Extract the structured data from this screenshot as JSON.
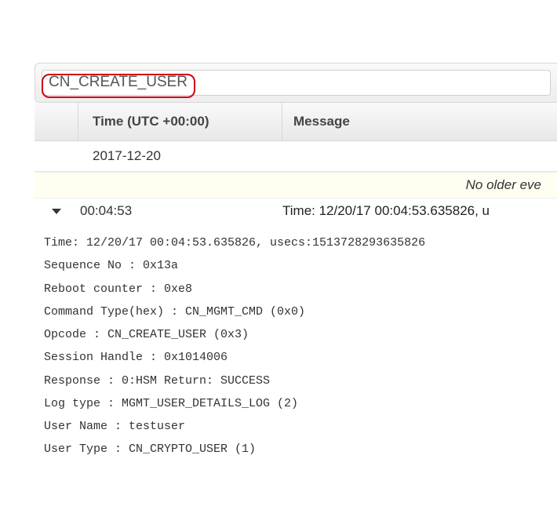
{
  "search": {
    "value": "CN_CREATE_USER"
  },
  "headers": {
    "time": "Time (UTC +00:00)",
    "message": "Message"
  },
  "dateGroup": "2017-12-20",
  "noOlder": "No older eve",
  "event": {
    "time": "00:04:53",
    "message": "Time: 12/20/17 00:04:53.635826, u"
  },
  "details": {
    "l0": "Time: 12/20/17 00:04:53.635826, usecs:1513728293635826",
    "l1": "Sequence No : 0x13a",
    "l2": "Reboot counter : 0xe8",
    "l3": "Command Type(hex) : CN_MGMT_CMD (0x0)",
    "l4": "Opcode : CN_CREATE_USER (0x3)",
    "l5": "Session Handle : 0x1014006",
    "l6": "Response : 0:HSM Return: SUCCESS",
    "l7": "Log type : MGMT_USER_DETAILS_LOG (2)",
    "l8": "User Name : testuser",
    "l9": "User Type : CN_CRYPTO_USER (1)"
  }
}
